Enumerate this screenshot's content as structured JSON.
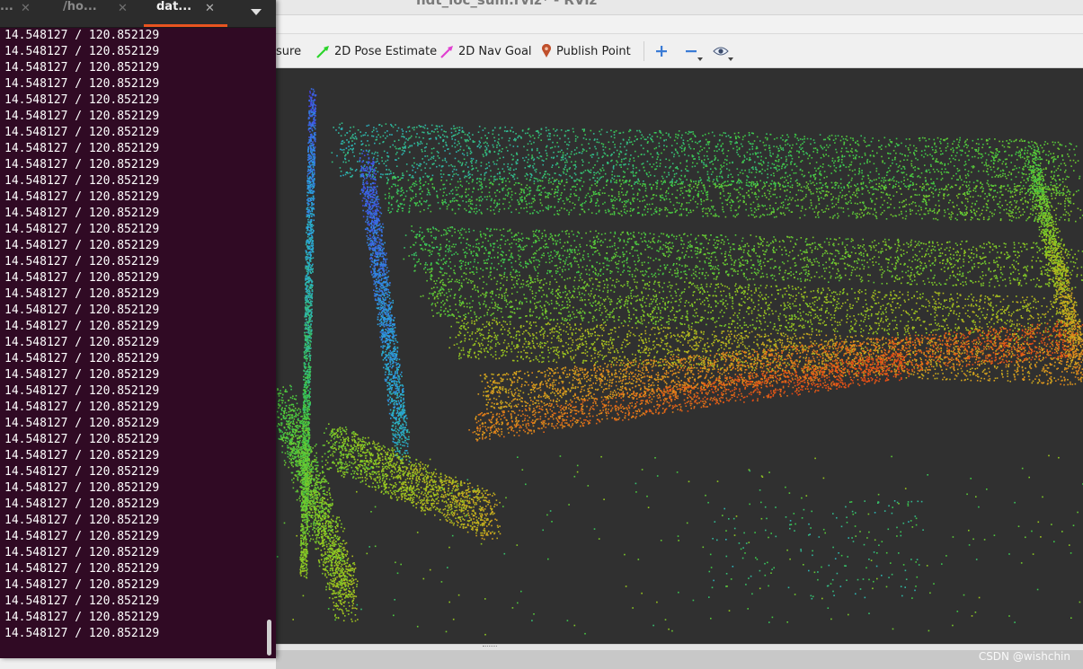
{
  "rviz": {
    "title": "ndt_loc_sum.rviz* - RViz",
    "toolbar": {
      "measure_label": "sure",
      "pose_estimate_label": "2D Pose Estimate",
      "nav_goal_label": "2D Nav Goal",
      "publish_point_label": "Publish Point"
    },
    "colors": {
      "viewport_bg": "#303030",
      "pose_estimate_arrow": "#2bd42b",
      "nav_goal_arrow": "#e040d0",
      "publish_point_pin": "#c0502c",
      "zoom_icons": "#3a7bd5"
    }
  },
  "terminal": {
    "tabs": [
      {
        "label": "...",
        "active": false
      },
      {
        "label": "/ho...",
        "active": false
      },
      {
        "label": "dat...",
        "active": true
      }
    ],
    "accent_color": "#e95420",
    "lines": [
      "14.548127 / 120.852129",
      "14.548127 / 120.852129",
      "14.548127 / 120.852129",
      "14.548127 / 120.852129",
      "14.548127 / 120.852129",
      "14.548127 / 120.852129",
      "14.548127 / 120.852129",
      "14.548127 / 120.852129",
      "14.548127 / 120.852129",
      "14.548127 / 120.852129",
      "14.548127 / 120.852129",
      "14.548127 / 120.852129",
      "14.548127 / 120.852129",
      "14.548127 / 120.852129",
      "14.548127 / 120.852129",
      "14.548127 / 120.852129",
      "14.548127 / 120.852129",
      "14.548127 / 120.852129",
      "14.548127 / 120.852129",
      "14.548127 / 120.852129",
      "14.548127 / 120.852129",
      "14.548127 / 120.852129",
      "14.548127 / 120.852129",
      "14.548127 / 120.852129",
      "14.548127 / 120.852129",
      "14.548127 / 120.852129",
      "14.548127 / 120.852129",
      "14.548127 / 120.852129",
      "14.548127 / 120.852129",
      "14.548127 / 120.852129",
      "14.548127 / 120.852129",
      "14.548127 / 120.852129",
      "14.548127 / 120.852129",
      "14.548127 / 120.852129",
      "14.548127 / 120.852129",
      "14.548127 / 120.852129",
      "14.548127 / 120.852129",
      "14.548127 / 120.852129"
    ]
  },
  "watermark": "CSDN @wishchin"
}
